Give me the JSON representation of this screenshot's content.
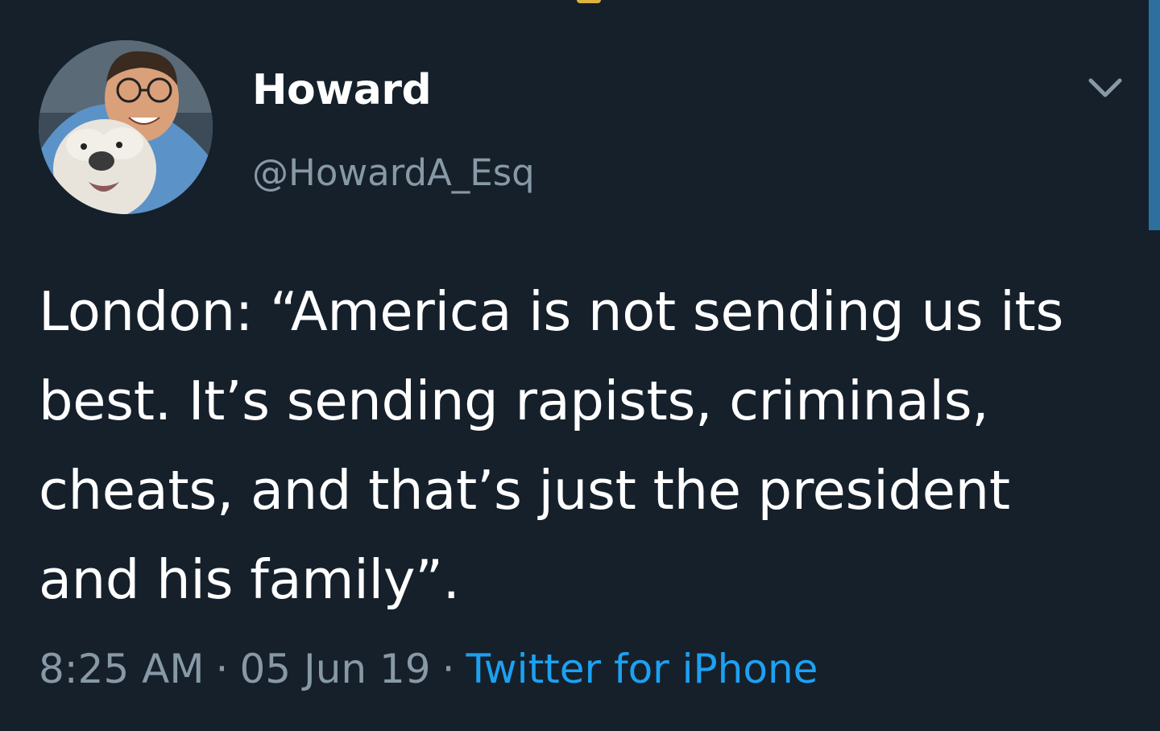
{
  "tweet": {
    "display_name": "Howard",
    "handle": "@HowardA_Esq",
    "text": "London: “America is not sending us its best. It’s sending rapists, criminals, cheats, and that’s just the president and his family”.",
    "time": "8:25 AM",
    "separator": "·",
    "date": "05 Jun 19",
    "source": "Twitter for iPhone"
  },
  "icons": {
    "menu": "chevron-down-icon",
    "avatar": "profile-photo"
  },
  "colors": {
    "background": "#15202b",
    "text_primary": "#ffffff",
    "text_secondary": "#8899a6",
    "link": "#1da1f2",
    "scrollbar": "#2f6f9f"
  }
}
